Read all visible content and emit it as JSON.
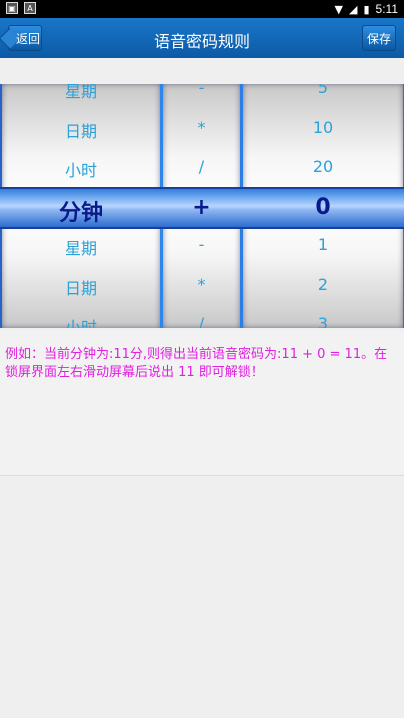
{
  "status_bar": {
    "time": "5:11"
  },
  "header": {
    "title": "语音密码规则",
    "back_label": "返回",
    "save_label": "保存"
  },
  "picker": {
    "columns": [
      {
        "items": [
          "星期",
          "日期",
          "小时",
          "分钟",
          "星期",
          "日期",
          "小时"
        ]
      },
      {
        "items": [
          "-",
          "*",
          "/",
          "+",
          "-",
          "*",
          "/"
        ]
      },
      {
        "items": [
          "5",
          "10",
          "20",
          "0",
          "1",
          "2",
          "3"
        ]
      }
    ],
    "selected": {
      "unit": "分钟",
      "operator": "+",
      "value": "0"
    }
  },
  "example": {
    "text": "例如：当前分钟为:11分,则得出当前语音密码为:11 + 0 = 11。在锁屏界面左右滑动屏幕后说出 11 即可解锁！"
  }
}
